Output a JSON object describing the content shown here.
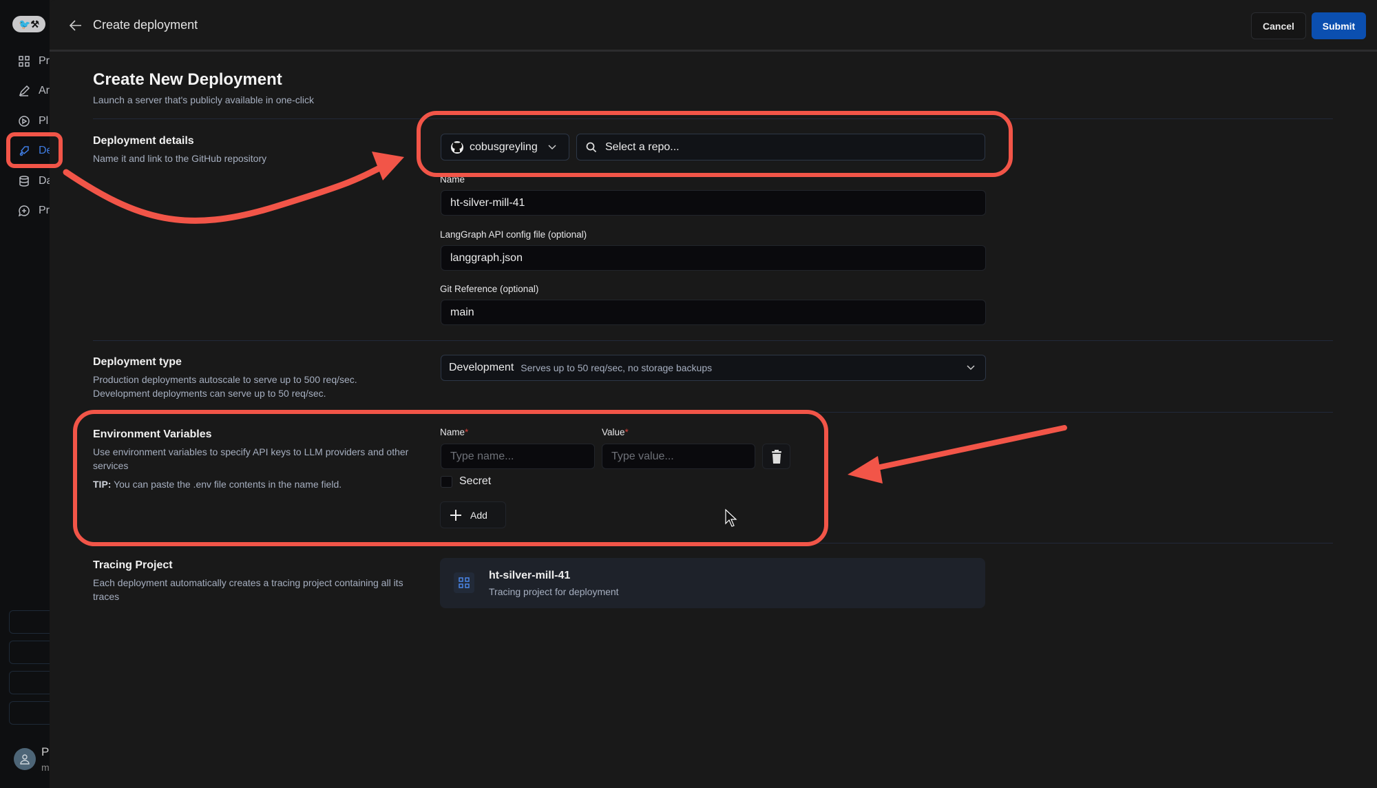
{
  "header": {
    "title": "Create deployment",
    "cancel": "Cancel",
    "submit": "Submit"
  },
  "sidebar": {
    "logo": "LangSmith logo",
    "items": [
      {
        "label": "Pr",
        "icon": "grid-icon"
      },
      {
        "label": "Ar",
        "icon": "pencil-icon"
      },
      {
        "label": "Pl",
        "icon": "play-icon"
      },
      {
        "label": "De",
        "icon": "rocket-icon",
        "active": true
      },
      {
        "label": "Da",
        "icon": "database-icon"
      },
      {
        "label": "Pr",
        "icon": "chat-plus-icon"
      }
    ],
    "user_initial": "P",
    "user_sub": "m"
  },
  "page": {
    "title": "Create New Deployment",
    "subtitle": "Launch a server that's publicly available in one-click"
  },
  "details": {
    "title": "Deployment details",
    "desc": "Name it and link to the GitHub repository",
    "account": "cobusgreyling",
    "repo_placeholder": "Select a repo...",
    "name_label": "Name",
    "name_value": "ht-silver-mill-41",
    "config_label": "LangGraph API config file (optional)",
    "config_value": "langgraph.json",
    "git_label": "Git Reference (optional)",
    "git_value": "main"
  },
  "type": {
    "title": "Deployment type",
    "desc1": "Production deployments autoscale to serve up to 500 req/sec.",
    "desc2": "Development deployments can serve up to 50 req/sec.",
    "selected": "Development",
    "selected_desc": "Serves up to 50 req/sec, no storage backups"
  },
  "env": {
    "title": "Environment Variables",
    "desc": "Use environment variables to specify API keys to LLM providers and other services",
    "tip_label": "TIP:",
    "tip": " You can paste the .env file contents in the name field.",
    "name_label": "Name",
    "value_label": "Value",
    "req": "*",
    "name_placeholder": "Type name...",
    "value_placeholder": "Type value...",
    "secret": "Secret",
    "secret_checked": false,
    "add": "Add"
  },
  "tracing": {
    "title": "Tracing Project",
    "desc": "Each deployment automatically creates a tracing project containing all its traces",
    "project": "ht-silver-mill-41",
    "project_sub": "Tracing project for deployment"
  },
  "colors": {
    "accent": "#0b4fb0",
    "annotation": "#f25548",
    "active_nav": "#3e7be0"
  }
}
